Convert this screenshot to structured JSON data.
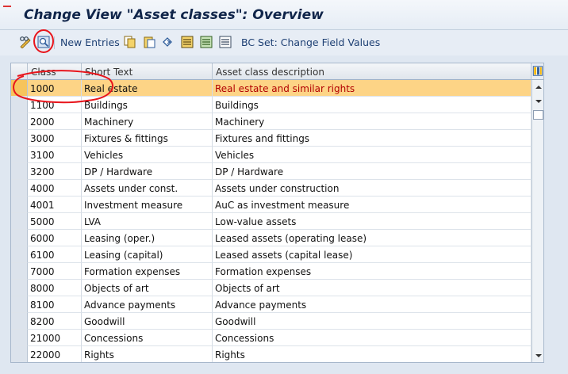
{
  "window": {
    "title": "Change View \"Asset classes\": Overview"
  },
  "toolbar": {
    "new_entries_label": "New Entries",
    "bc_set_label": "BC Set: Change Field Values",
    "icons": [
      "display-change-icon",
      "details-icon",
      "copy-icon",
      "paste-icon",
      "undo-icon",
      "select-all-icon",
      "select-block-icon",
      "deselect-all-icon",
      "bc-set-icon"
    ]
  },
  "table": {
    "headers": {
      "class": "Class",
      "short_text": "Short Text",
      "description": "Asset class description"
    },
    "rows": [
      {
        "class": "1000",
        "short_text": "Real estate",
        "description": "Real estate and similar rights"
      },
      {
        "class": "1100",
        "short_text": "Buildings",
        "description": "Buildings"
      },
      {
        "class": "2000",
        "short_text": "Machinery",
        "description": "Machinery"
      },
      {
        "class": "3000",
        "short_text": "Fixtures & fittings",
        "description": "Fixtures and fittings"
      },
      {
        "class": "3100",
        "short_text": "Vehicles",
        "description": "Vehicles"
      },
      {
        "class": "3200",
        "short_text": "DP / Hardware",
        "description": "DP / Hardware"
      },
      {
        "class": "4000",
        "short_text": "Assets under const.",
        "description": "Assets under construction"
      },
      {
        "class": "4001",
        "short_text": "Investment measure",
        "description": "AuC as investment measure"
      },
      {
        "class": "5000",
        "short_text": "LVA",
        "description": "Low-value assets"
      },
      {
        "class": "6000",
        "short_text": "Leasing (oper.)",
        "description": "Leased assets (operating lease)"
      },
      {
        "class": "6100",
        "short_text": "Leasing (capital)",
        "description": "Leased assets (capital lease)"
      },
      {
        "class": "7000",
        "short_text": "Formation expenses",
        "description": "Formation expenses"
      },
      {
        "class": "8000",
        "short_text": "Objects of art",
        "description": "Objects of art"
      },
      {
        "class": "8100",
        "short_text": "Advance payments",
        "description": "Advance payments"
      },
      {
        "class": "8200",
        "short_text": "Goodwill",
        "description": "Goodwill"
      },
      {
        "class": "21000",
        "short_text": "Concessions",
        "description": "Concessions"
      },
      {
        "class": "22000",
        "short_text": "Rights",
        "description": "Rights"
      }
    ]
  },
  "colors": {
    "highlight_row": "#fdd486",
    "highlight_text": "#b20000",
    "annotation": "#e8141b"
  }
}
